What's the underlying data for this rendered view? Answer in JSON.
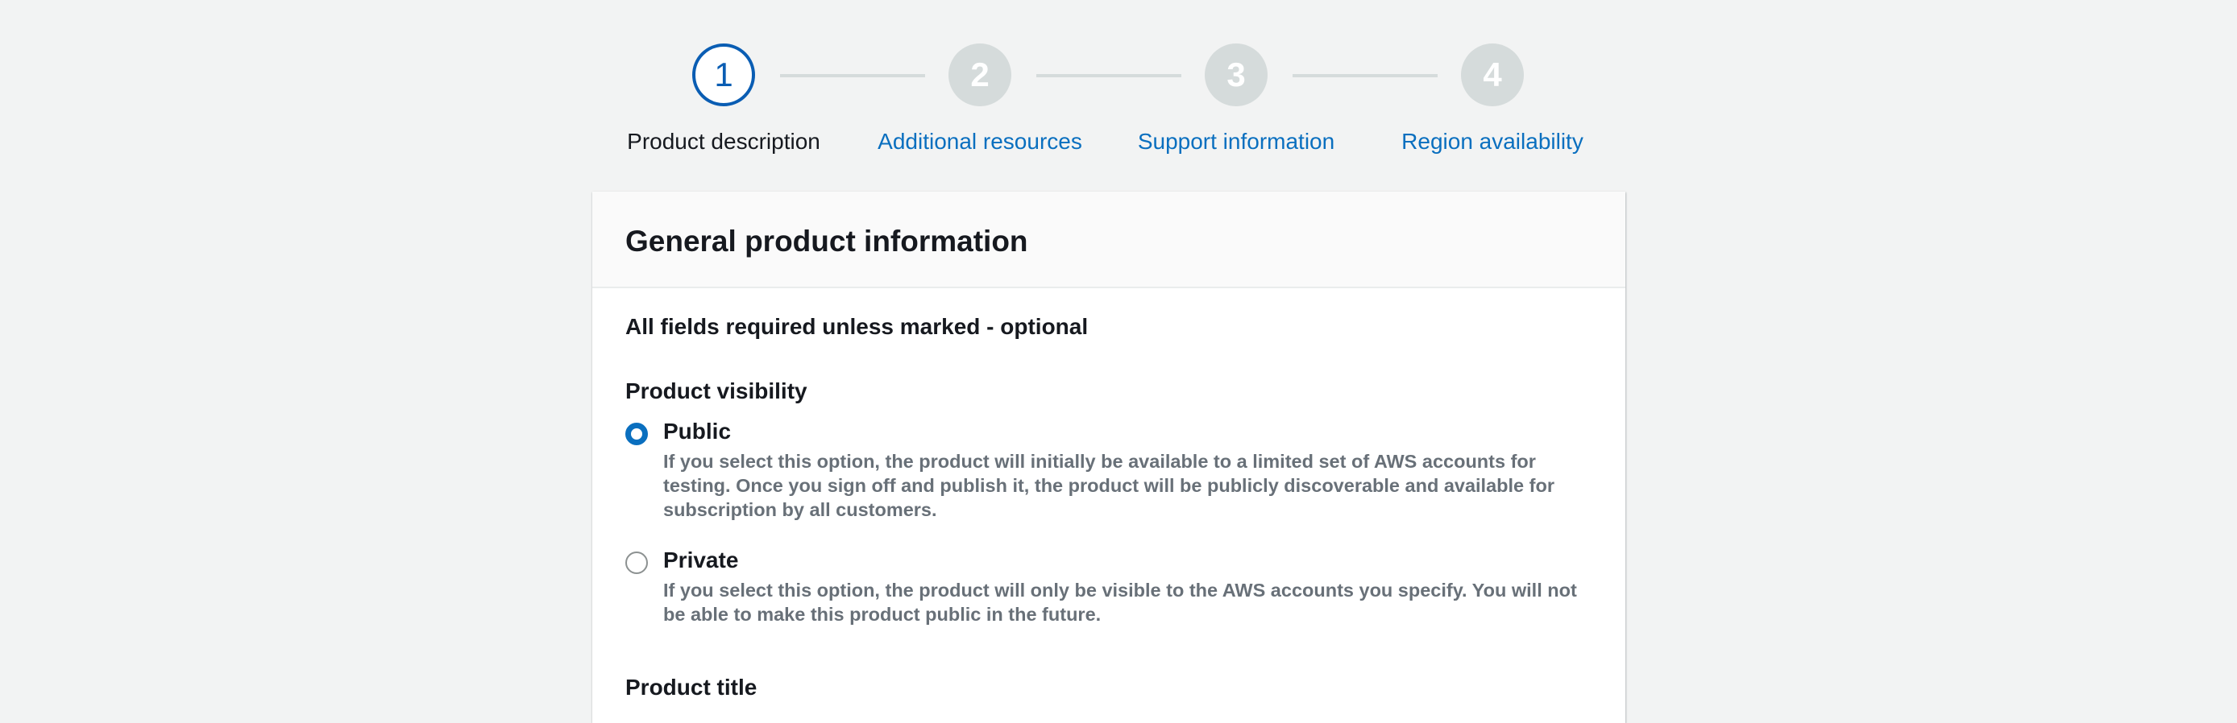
{
  "stepper": {
    "steps": [
      {
        "number": "1",
        "label": "Product description",
        "state": "active"
      },
      {
        "number": "2",
        "label": "Additional resources",
        "state": "upcoming"
      },
      {
        "number": "3",
        "label": "Support information",
        "state": "upcoming"
      },
      {
        "number": "4",
        "label": "Region availability",
        "state": "upcoming"
      }
    ]
  },
  "card": {
    "title": "General product information",
    "required_note": "All fields required unless marked - optional",
    "visibility": {
      "label": "Product visibility",
      "selected": "Public",
      "options": [
        {
          "title": "Public",
          "description": "If you select this option, the product will initially be available to a limited set of AWS accounts for testing. Once you sign off and publish it, the product will be publicly discoverable and available for subscription by all customers."
        },
        {
          "title": "Private",
          "description": "If you select this option, the product will only be visible to the AWS accounts you specify. You will not be able to make this product public in the future."
        }
      ]
    },
    "product_title_label": "Product title"
  },
  "colors": {
    "page_background": "#f2f3f3",
    "accent": "#0a6fbf",
    "inactive_step": "#d5dbdb",
    "muted_text": "#687078"
  }
}
